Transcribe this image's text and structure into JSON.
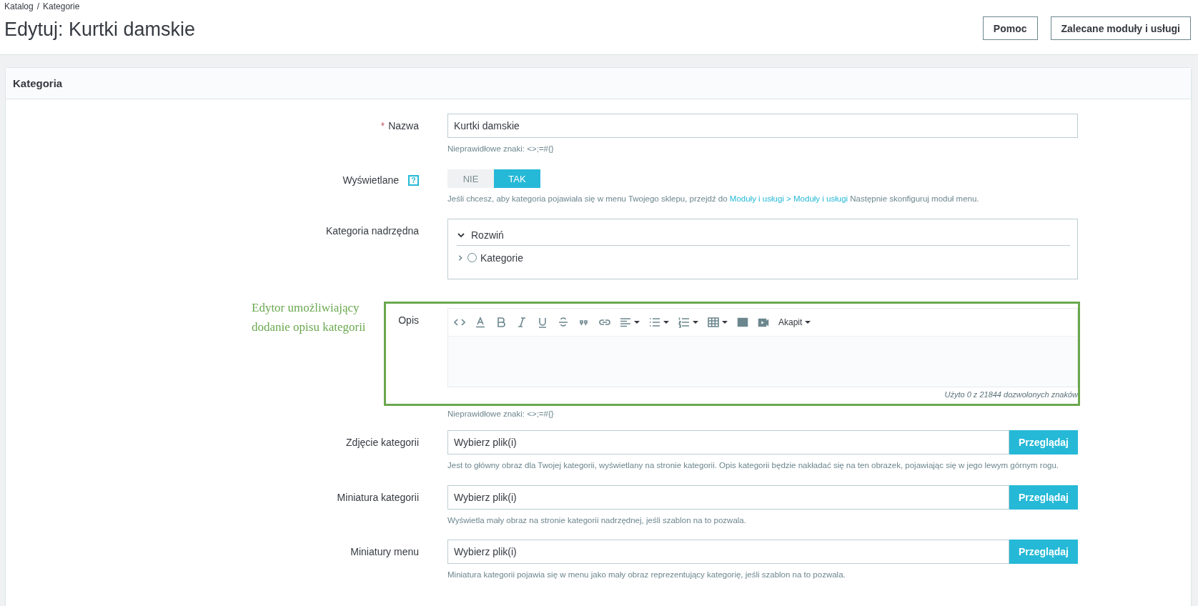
{
  "breadcrumb": {
    "items": [
      "Katalog",
      "Kategorie"
    ],
    "separator": "/"
  },
  "page_title": "Edytuj: Kurtki damskie",
  "header_buttons": [
    "Pomoc",
    "Zalecane moduły i usługi"
  ],
  "card": {
    "title": "Kategoria"
  },
  "fields": [
    {
      "kind": "text",
      "label": "Nazwa",
      "required": true,
      "required_mark": "*",
      "value": "Kurtki damskie",
      "help": "Nieprawidłowe znaki: <>;=#{}"
    },
    {
      "kind": "toggle",
      "label": "Wyświetlane",
      "help_icon": "?",
      "options": [
        {
          "label": "NIE",
          "selected": false
        },
        {
          "label": "TAK",
          "selected": true
        }
      ],
      "help": {
        "before": "Jeśli chcesz, aby kategoria pojawiała się w menu Twojego sklepu, przejdź do ",
        "link": "Moduły i usługi > Moduły i usługi",
        "after": " Następnie skonfiguruj moduł menu."
      }
    },
    {
      "kind": "tree",
      "label": "Kategoria nadrzędna",
      "expand": "Rozwiń",
      "nodes": [
        {
          "label": "Kategorie",
          "selected": false
        }
      ]
    },
    {
      "kind": "editor",
      "label": "Opis",
      "annotation": "Edytor umożliwiający dodanie opisu kategorii",
      "paragraph_dropdown": "Akapit",
      "counter": "Użyto 0 z 21844 dozwolonych znaków",
      "help": "Nieprawidłowe znaki: <>;=#{}"
    },
    {
      "kind": "file",
      "label": "Zdjęcie kategorii",
      "placeholder": "Wybierz plik(i)",
      "button": "Przeglądaj",
      "help": "Jest to główny obraz dla Twojej kategorii, wyświetlany na stronie kategorii. Opis kategorii będzie nakładać się na ten obrazek, pojawiając się w jego lewym górnym rogu."
    },
    {
      "kind": "file",
      "label": "Miniatura kategorii",
      "placeholder": "Wybierz plik(i)",
      "button": "Przeglądaj",
      "help": "Wyświetla mały obraz na stronie kategorii nadrzędnej, jeśli szablon na to pozwala."
    },
    {
      "kind": "file",
      "label": "Miniatury menu",
      "placeholder": "Wybierz plik(i)",
      "button": "Przeglądaj",
      "help": "Miniatura kategorii pojawia się w menu jako mały obraz reprezentujący kategorię, jeśli szablon na to pozwala."
    }
  ]
}
